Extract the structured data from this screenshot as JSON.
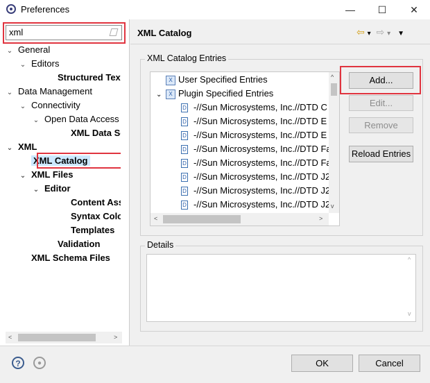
{
  "window": {
    "title": "Preferences",
    "minimize_glyph": "—",
    "maximize_glyph": "☐",
    "close_glyph": "✕"
  },
  "filter": {
    "value": "xml"
  },
  "tree": [
    {
      "label": "General",
      "indent": 0,
      "twisty": "v",
      "bold": false
    },
    {
      "label": "Editors",
      "indent": 1,
      "twisty": "v",
      "bold": false
    },
    {
      "label": "Structured Text E",
      "indent": 3,
      "twisty": "",
      "bold": true
    },
    {
      "label": "Data Management",
      "indent": 0,
      "twisty": "v",
      "bold": false
    },
    {
      "label": "Connectivity",
      "indent": 1,
      "twisty": "v",
      "bold": false
    },
    {
      "label": "Open Data Access",
      "indent": 2,
      "twisty": "v",
      "bold": false
    },
    {
      "label": "XML Data Set",
      "indent": 4,
      "twisty": "",
      "bold": true
    },
    {
      "label": "XML",
      "indent": 0,
      "twisty": "v",
      "bold": true
    },
    {
      "label": "XML Catalog",
      "indent": 1,
      "twisty": "",
      "bold": true,
      "selected": true
    },
    {
      "label": "XML Files",
      "indent": 1,
      "twisty": "v",
      "bold": true
    },
    {
      "label": "Editor",
      "indent": 2,
      "twisty": "v",
      "bold": true
    },
    {
      "label": "Content Assis",
      "indent": 4,
      "twisty": "",
      "bold": true
    },
    {
      "label": "Syntax Colori",
      "indent": 4,
      "twisty": "",
      "bold": true
    },
    {
      "label": "Templates",
      "indent": 4,
      "twisty": "",
      "bold": true
    },
    {
      "label": "Validation",
      "indent": 3,
      "twisty": "",
      "bold": true
    },
    {
      "label": "XML Schema Files",
      "indent": 1,
      "twisty": "",
      "bold": true
    }
  ],
  "page": {
    "title": "XML Catalog",
    "entries_group_label": "XML Catalog Entries",
    "details_group_label": "Details"
  },
  "entries": [
    {
      "label": "User Specified Entries",
      "type": "catalog",
      "level": 0
    },
    {
      "label": "Plugin Specified Entries",
      "type": "catalog",
      "level": 0,
      "expanded": true
    },
    {
      "label": "-//Sun Microsystems, Inc.//DTD C",
      "type": "dtd",
      "level": 1
    },
    {
      "label": "-//Sun Microsystems, Inc.//DTD E",
      "type": "dtd",
      "level": 1
    },
    {
      "label": "-//Sun Microsystems, Inc.//DTD E",
      "type": "dtd",
      "level": 1
    },
    {
      "label": "-//Sun Microsystems, Inc.//DTD Fa",
      "type": "dtd",
      "level": 1
    },
    {
      "label": "-//Sun Microsystems, Inc.//DTD Fa",
      "type": "dtd",
      "level": 1
    },
    {
      "label": "-//Sun Microsystems, Inc.//DTD J2",
      "type": "dtd",
      "level": 1
    },
    {
      "label": "-//Sun Microsystems, Inc.//DTD J2",
      "type": "dtd",
      "level": 1
    },
    {
      "label": "-//Sun Microsystems, Inc.//DTD J2",
      "type": "dtd",
      "level": 1
    }
  ],
  "buttons": {
    "add": "Add...",
    "edit": "Edit...",
    "remove": "Remove",
    "reload": "Reload Entries",
    "ok": "OK",
    "cancel": "Cancel"
  },
  "icons": {
    "help": "?",
    "import": "●",
    "back": "⇦",
    "forward": "⇨",
    "dropdown": "▾",
    "menu": "▼"
  },
  "colors": {
    "highlight": "#e0343f",
    "selection": "#cce8ff"
  }
}
